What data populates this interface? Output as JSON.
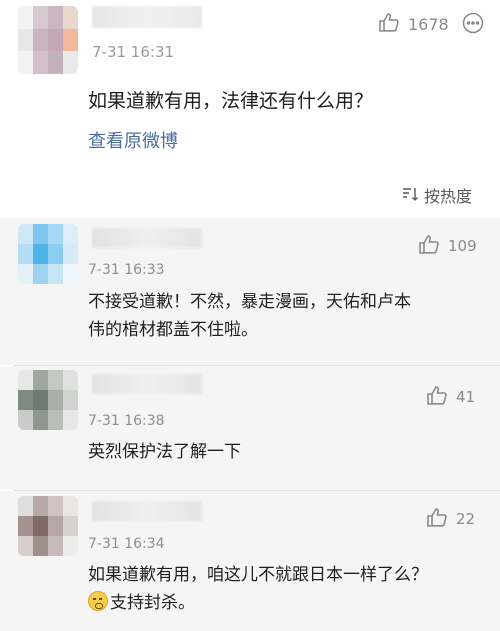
{
  "post": {
    "time": "7-31 16:31",
    "likes": "1678",
    "text": "如果道歉有用，法律还有什么用？",
    "view_original": "查看原微博",
    "sort_label": "按热度",
    "avatar_colors": [
      "#f2f2f2",
      "#d8c8cf",
      "#cbb5c2",
      "#e9d6cd",
      "#e7e7e7",
      "#cab4c4",
      "#c4a8ba",
      "#f1b89a",
      "#f2f2f2",
      "#d2c0cb",
      "#c3b2bd",
      "#e9e9e9"
    ]
  },
  "comments": [
    {
      "time": "7-31 16:33",
      "likes": "109",
      "text": "不接受道歉！不然，暴走漫画，天佑和卢本伟的棺材都盖不住啦。",
      "avatar_colors": [
        "#cfe6f5",
        "#7fc6ee",
        "#a6d8f4",
        "#dceef8",
        "#b4def6",
        "#4fb3e8",
        "#8bcdf0",
        "#d7ebf6",
        "#e5f1f8",
        "#9ed3f0",
        "#c6e5f6",
        "#eef6fb"
      ]
    },
    {
      "time": "7-31 16:38",
      "likes": "41",
      "text": "英烈保护法了解一下",
      "avatar_colors": [
        "#e8e8e8",
        "#9ea7a0",
        "#c4c8c2",
        "#dfe1de",
        "#7e8b82",
        "#6e7a71",
        "#a7b0a9",
        "#d0d3cf",
        "#c9ccc8",
        "#8e9891",
        "#b8beb9",
        "#e6e7e6"
      ]
    },
    {
      "time": "7-31 16:34",
      "likes": "22",
      "text_line1": "如果道歉有用，咱这儿不就跟日本一样了么？",
      "text_line2": "支持封杀。",
      "avatar_colors": [
        "#dedede",
        "#b8a9a6",
        "#cfc3c0",
        "#ebe6e5",
        "#a39290",
        "#806a67",
        "#b7a7a4",
        "#d9d1cf",
        "#d6cfce",
        "#9f8f8c",
        "#c7bbb9",
        "#ececec"
      ]
    }
  ],
  "icons": {
    "like": "thumbs-up-icon",
    "more": "more-icon",
    "sort": "sort-icon",
    "emoji": "emoji-icon"
  },
  "colors": {
    "link": "#4a6ea0",
    "comment_bg": "#f5f5f5",
    "meta": "#8e8e8e"
  }
}
